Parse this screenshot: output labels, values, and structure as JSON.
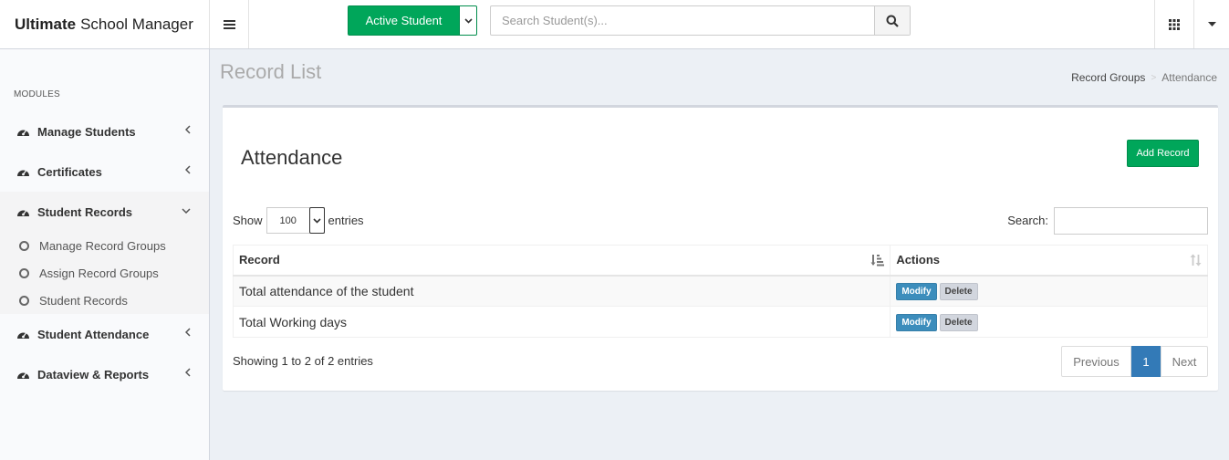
{
  "header": {
    "brand_bold": "Ultimate",
    "brand_rest": "School Manager",
    "active_button": "Active Student",
    "search_placeholder": "Search Student(s)..."
  },
  "sidebar": {
    "section_label": "MODULES",
    "items": [
      {
        "label": "Manage Students"
      },
      {
        "label": "Certificates"
      },
      {
        "label": "Student Records"
      },
      {
        "label": "Student Attendance"
      },
      {
        "label": "Dataview & Reports"
      }
    ],
    "subitems": [
      {
        "label": "Manage Record Groups"
      },
      {
        "label": "Assign Record Groups"
      },
      {
        "label": "Student Records"
      }
    ]
  },
  "page": {
    "title": "Record List",
    "breadcrumb": [
      "Record Groups",
      "Attendance"
    ]
  },
  "box": {
    "title": "Attendance",
    "add_button": "Add Record",
    "show_label": "Show",
    "show_value": "100",
    "entries_label": "entries",
    "search_label": "Search:",
    "columns": [
      "Record",
      "Actions"
    ],
    "rows": [
      {
        "record": "Total attendance of the student",
        "modify": "Modify",
        "delete": "Delete"
      },
      {
        "record": "Total Working days",
        "modify": "Modify",
        "delete": "Delete"
      }
    ],
    "info": "Showing 1 to 2 of 2 entries",
    "pager": {
      "prev": "Previous",
      "current": "1",
      "next": "Next"
    }
  },
  "colors": {
    "green": "#00a65a",
    "blue": "#3c8dbc",
    "pager_blue": "#337ab7"
  }
}
